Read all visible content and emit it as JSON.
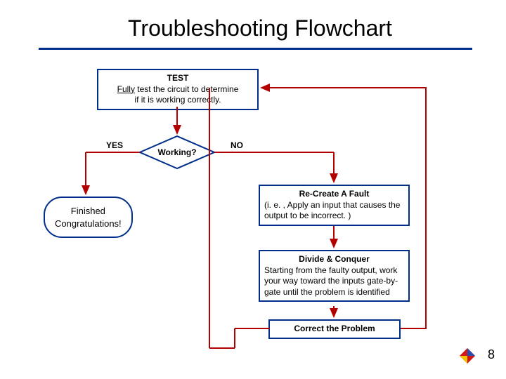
{
  "title": "Troubleshooting Flowchart",
  "test": {
    "heading": "TEST",
    "line1_u": "Fully",
    "line1_rest": " test the circuit to determine",
    "line2": "if it is working correctly."
  },
  "decision": {
    "label": "Working?",
    "yes": "YES",
    "no": "NO"
  },
  "finished": {
    "line1": "Finished",
    "line2": "Congratulations!"
  },
  "recreate": {
    "heading": "Re-Create A Fault",
    "body": "(i. e. , Apply an input that causes the output to be incorrect. )"
  },
  "divide": {
    "heading": "Divide & Conquer",
    "body": "Starting from the faulty output, work your way toward the inputs gate-by-gate until the problem is identified"
  },
  "correct": {
    "heading": "Correct the Problem"
  },
  "page_number": "8",
  "colors": {
    "border": "#002f8b",
    "arrow": "#b30000"
  }
}
